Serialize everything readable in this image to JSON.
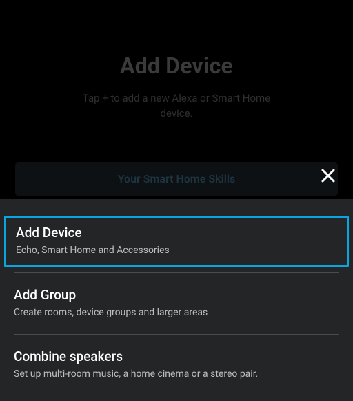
{
  "header": {
    "title": "Add Device",
    "subtitle": "Tap + to add a new Alexa or Smart Home device.",
    "skills_label": "Your Smart Home Skills"
  },
  "close": {
    "name": "close"
  },
  "menu": {
    "items": [
      {
        "title": "Add Device",
        "subtitle": "Echo, Smart Home and Accessories",
        "highlighted": true
      },
      {
        "title": "Add Group",
        "subtitle": "Create rooms, device groups and larger areas"
      },
      {
        "title": "Combine speakers",
        "subtitle": "Set up multi-room music, a home cinema or a stereo pair."
      }
    ]
  },
  "colors": {
    "highlight": "#0aa4e0",
    "sheet_bg": "#232526"
  }
}
